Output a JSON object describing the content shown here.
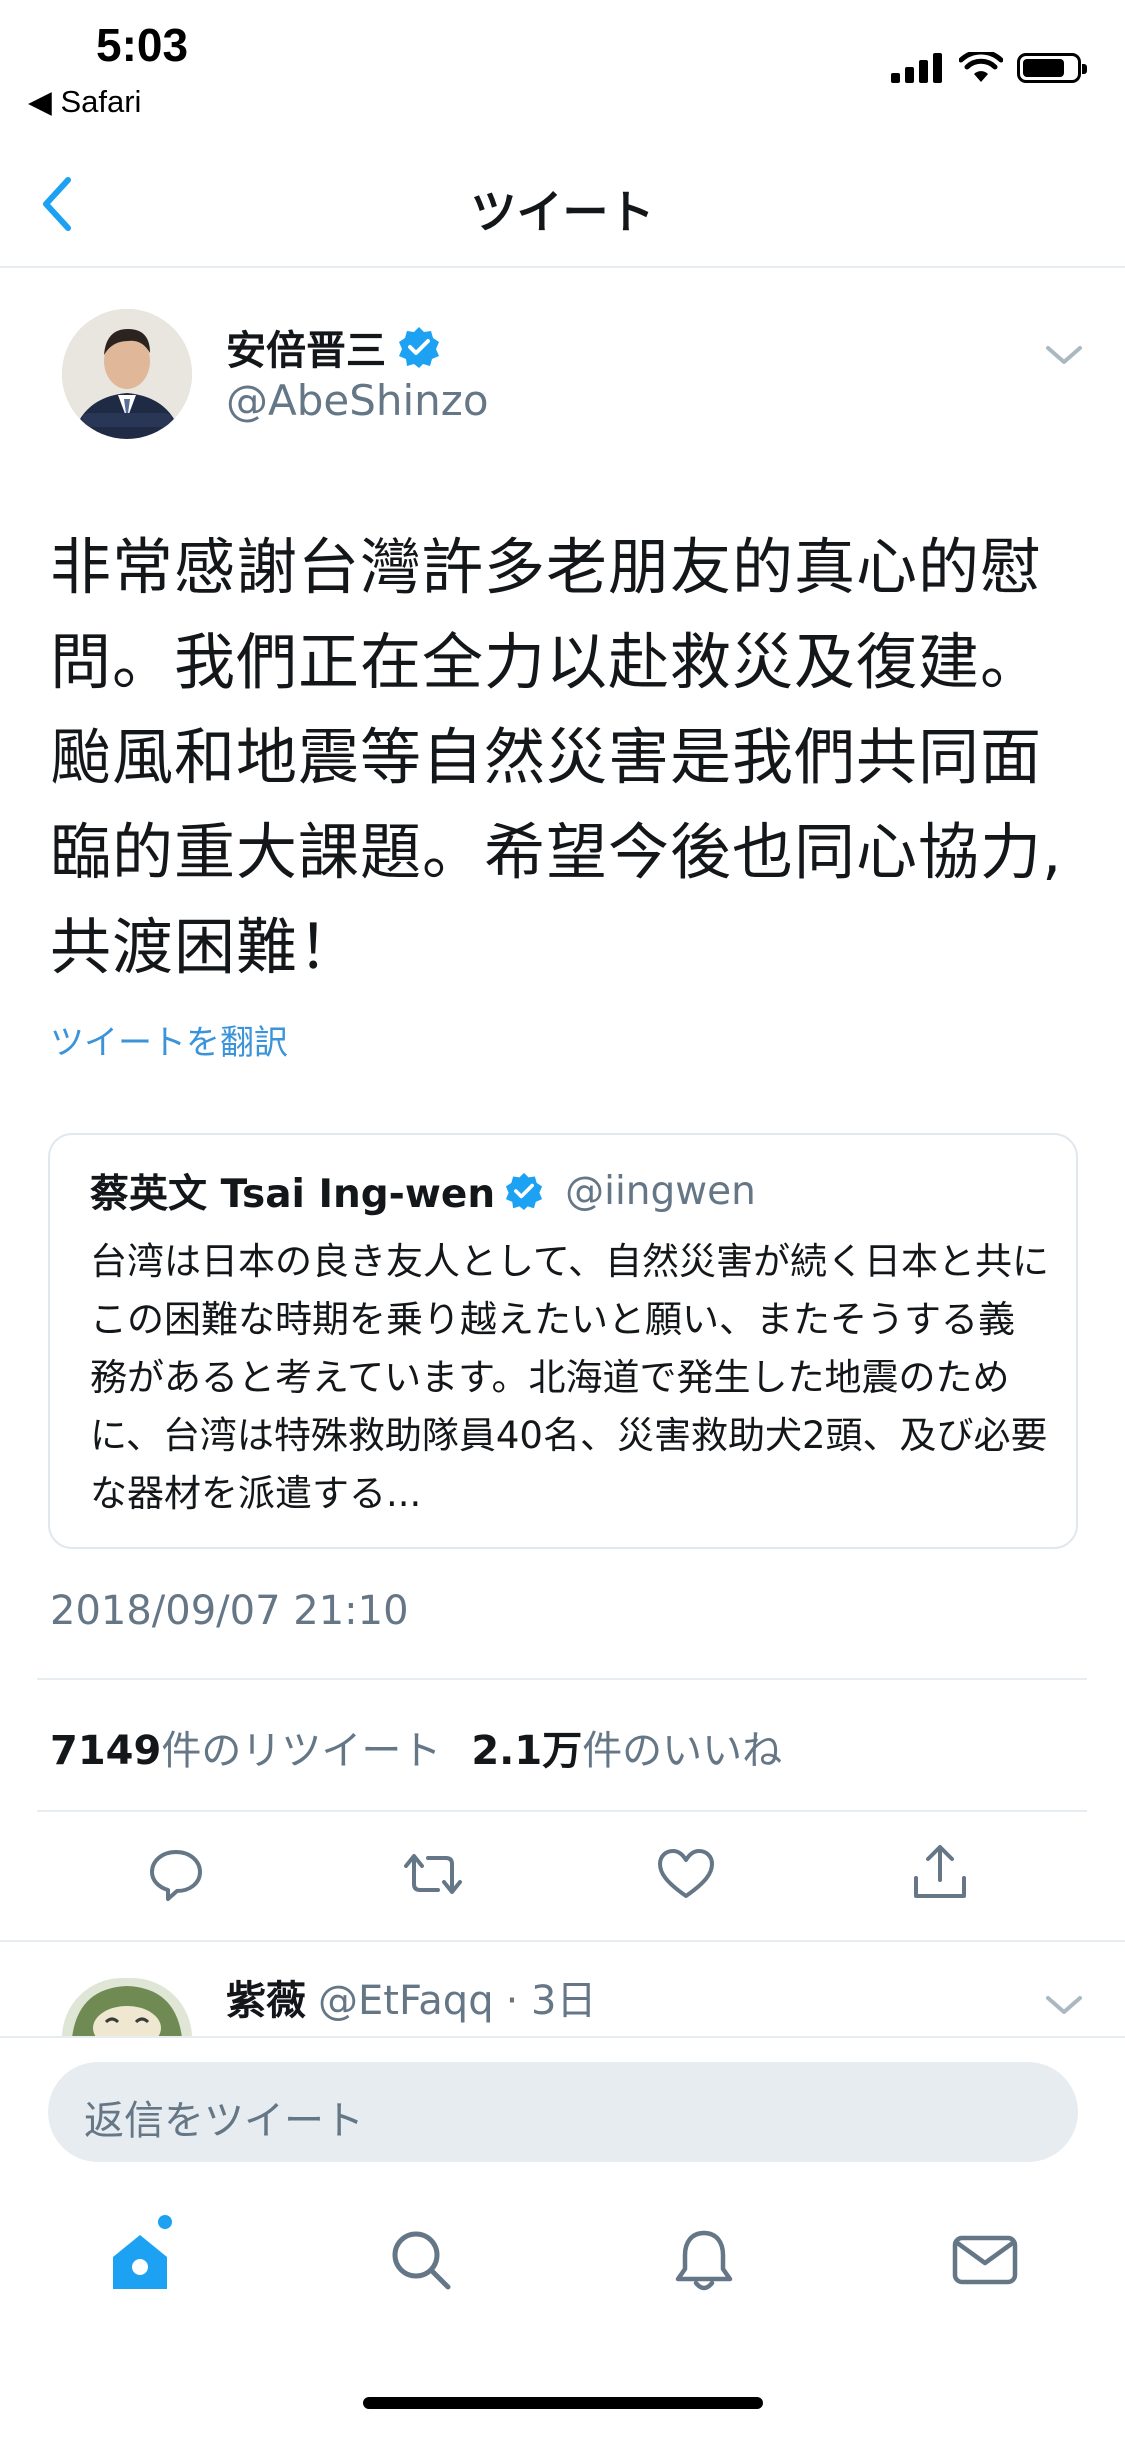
{
  "status_bar": {
    "time": "5:03",
    "back_label": "◀ Safari"
  },
  "nav": {
    "title": "ツイート"
  },
  "tweet": {
    "author_name": "安倍晋三",
    "author_handle": "@AbeShinzo",
    "body": "非常感謝台灣許多老朋友的真心的慰問。我們正在全力以赴救災及復建。颱風和地震等自然災害是我們共同面臨的重大課題。希望今後也同心協力,共渡困難！",
    "translate_label": "ツイートを翻訳",
    "timestamp": "2018/09/07 21:10"
  },
  "quote": {
    "name": "蔡英文 Tsai Ing-wen",
    "handle": "@iingwen",
    "text": "台湾は日本の良き友人として、自然災害が続く日本と共にこの困難な時期を乗り越えたいと願い、またそうする義務があると考えています。北海道で発生した地震のために、台湾は特殊救助隊員40名、災害救助犬2頭、及び必要な器材を派遣する..."
  },
  "stats": {
    "retweet_count": "7149",
    "retweet_label": "件のリツイート",
    "like_count": "2.1万",
    "like_label": "件のいいね"
  },
  "reply": {
    "name": "紫薇",
    "handle": "@EtFaqq",
    "time": "· 3日"
  },
  "composer": {
    "placeholder": "返信をツイート"
  },
  "colors": {
    "accent": "#1da1f2",
    "link": "#3b94d9",
    "muted": "#657786",
    "divider": "#e6ecf0"
  },
  "icons": [
    "back-chevron-icon",
    "verified-badge-icon",
    "chevron-down-icon",
    "reply-icon",
    "retweet-icon",
    "like-icon",
    "share-icon",
    "home-icon",
    "search-icon",
    "notifications-icon",
    "messages-icon",
    "signal-icon",
    "wifi-icon",
    "battery-icon"
  ]
}
